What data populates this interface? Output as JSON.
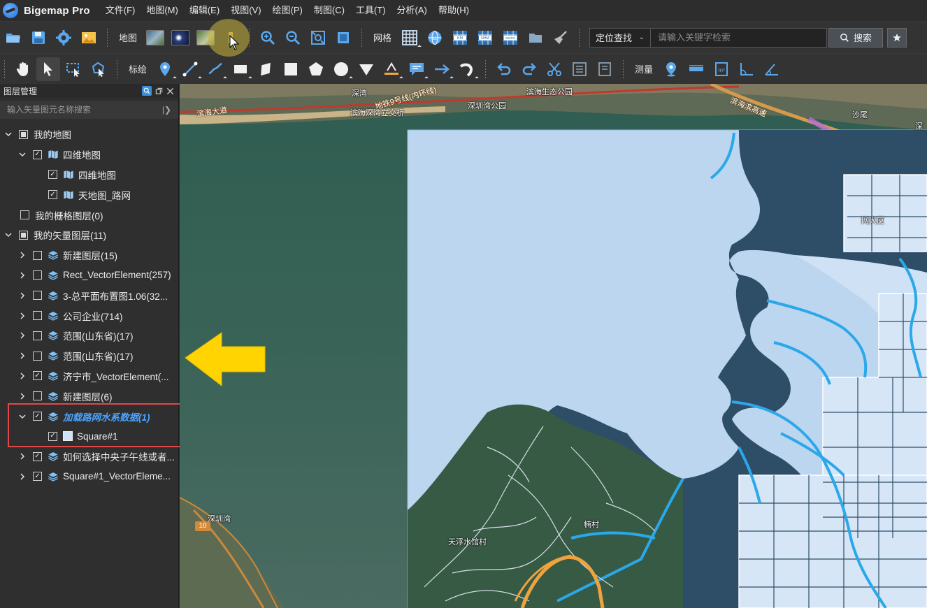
{
  "app": {
    "title": "Bigemap Pro"
  },
  "menu": [
    "文件(F)",
    "地图(M)",
    "编辑(E)",
    "视图(V)",
    "绘图(P)",
    "制图(C)",
    "工具(T)",
    "分析(A)",
    "帮助(H)"
  ],
  "toolbar1": {
    "map_label": "地图",
    "grid_label": "网格",
    "locate_select": "定位查找",
    "search_placeholder": "请输入关键字检索",
    "search_button": "搜索",
    "grid_badges": [
      "LL",
      "KM",
      "NHM",
      "MGRS"
    ]
  },
  "toolbar2": {
    "draw_label": "标绘",
    "measure_label": "测量"
  },
  "sidebar": {
    "title": "图层管理",
    "filter_placeholder": "输入矢量图元名称搜索",
    "tree": [
      {
        "label": "我的地图"
      },
      {
        "label": "四维地图"
      },
      {
        "label": "四维地图"
      },
      {
        "label": "天地图_路网"
      },
      {
        "label": "我的栅格图层(0)"
      },
      {
        "label": "我的矢量图层(11)"
      },
      {
        "label": "新建图层(15)"
      },
      {
        "label": "Rect_VectorElement(257)"
      },
      {
        "label": "3-总平面布置图1.06(32..."
      },
      {
        "label": "公司企业(714)"
      },
      {
        "label": "范围(山东省)(17)"
      },
      {
        "label": "范围(山东省)(17)"
      },
      {
        "label": "济宁市_VectorElement(..."
      },
      {
        "label": "新建图层(6)"
      },
      {
        "label": "加载路网水系数据(1)"
      },
      {
        "label": "Square#1"
      },
      {
        "label": "如何选择中央子午线或者..."
      },
      {
        "label": "Square#1_VectorEleme..."
      }
    ]
  },
  "map": {
    "labels": [
      "深湾",
      "滨海大道",
      "滨海深湾立交桥",
      "地铁9号线(内环线)",
      "深圳湾公园",
      "滨海生态公园",
      "滨海滨高速",
      "沙尾",
      "深",
      "深圳湾",
      "楠村",
      "天浮水馆村",
      "网大厦"
    ],
    "route_shield": "10"
  }
}
